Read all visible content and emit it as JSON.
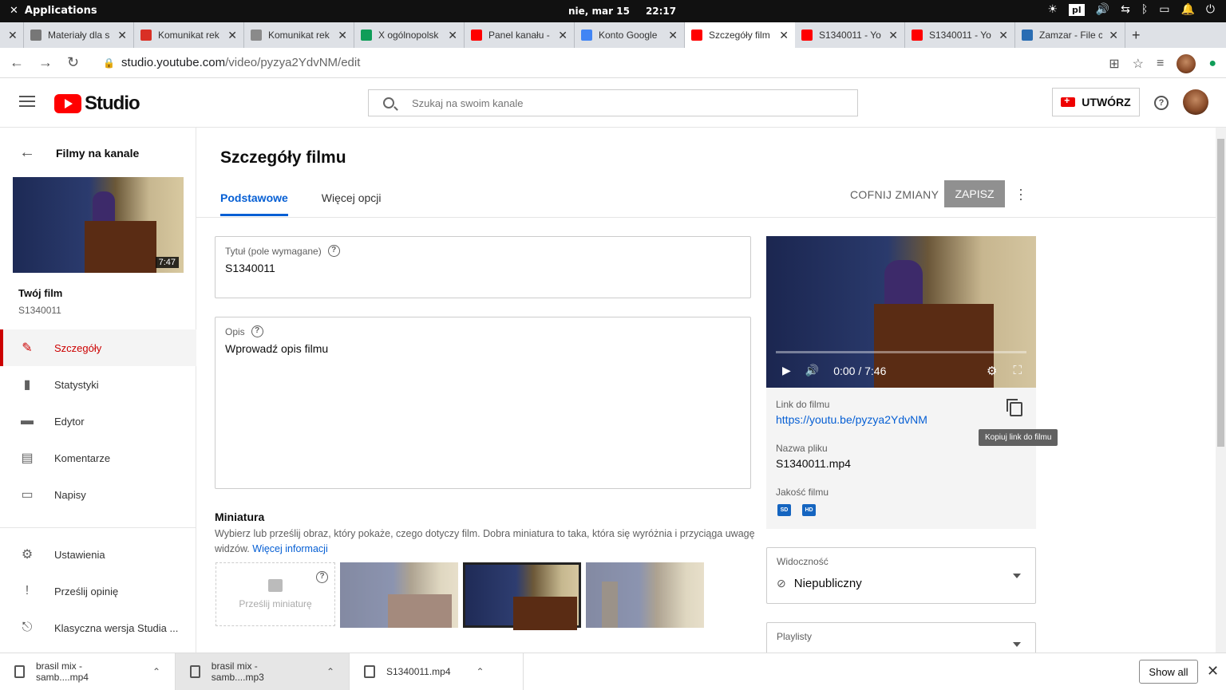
{
  "system_bar": {
    "apps_label": "Applications",
    "date": "nie, mar 15",
    "time": "22:17",
    "lang": "pl"
  },
  "browser_tabs": [
    {
      "title": "Materiały dla s",
      "color": "#777777"
    },
    {
      "title": "Komunikat rek",
      "color": "#d93025"
    },
    {
      "title": "Komunikat rek",
      "color": "#8a8a8a"
    },
    {
      "title": "X ogólnopolsk",
      "color": "#0f9d58"
    },
    {
      "title": "Panel kanału -",
      "color": "#ff0000"
    },
    {
      "title": "Konto Google",
      "color": "#4285f4"
    },
    {
      "title": "Szczegóły film",
      "color": "#ff0000",
      "active": true
    },
    {
      "title": "S1340011 - Yo",
      "color": "#ff0000"
    },
    {
      "title": "S1340011 - Yo",
      "color": "#ff0000"
    },
    {
      "title": "Zamzar - File c",
      "color": "#2a6db3"
    }
  ],
  "address_bar": {
    "domain": "studio.youtube.com",
    "path": "/video/pyzya2YdvNM/edit"
  },
  "studio_header": {
    "logo_text": "Studio",
    "search_placeholder": "Szukaj na swoim kanale",
    "create_label": "UTWÓRZ",
    "help_label": "?"
  },
  "sidebar": {
    "back_label": "Filmy na kanale",
    "thumb_duration": "7:47",
    "your_film_label": "Twój film",
    "your_film_id": "S1340011",
    "items": [
      {
        "label": "Szczegóły",
        "icon": "pencil-icon",
        "glyph": "✎",
        "active": true
      },
      {
        "label": "Statystyki",
        "icon": "analytics-icon",
        "glyph": "▮"
      },
      {
        "label": "Edytor",
        "icon": "editor-icon",
        "glyph": "▬"
      },
      {
        "label": "Komentarze",
        "icon": "comments-icon",
        "glyph": "▤"
      },
      {
        "label": "Napisy",
        "icon": "subtitles-icon",
        "glyph": "▭"
      }
    ],
    "bottom_items": [
      {
        "label": "Ustawienia",
        "icon": "gear-icon",
        "glyph": "⚙"
      },
      {
        "label": "Prześlij opinię",
        "icon": "feedback-icon",
        "glyph": "!"
      },
      {
        "label": "Klasyczna wersja Studia ...",
        "icon": "classic-icon",
        "glyph": "⎋"
      }
    ]
  },
  "main": {
    "page_title": "Szczegóły filmu",
    "tabs": [
      {
        "label": "Podstawowe",
        "active": true
      },
      {
        "label": "Więcej opcji"
      }
    ],
    "undo_label": "COFNIJ ZMIANY",
    "save_label": "ZAPISZ",
    "title_field": {
      "label": "Tytuł (pole wymagane)",
      "value": "S1340011"
    },
    "description_field": {
      "label": "Opis",
      "value": "Wprowadź opis filmu"
    },
    "thumbnail": {
      "heading": "Miniatura",
      "description": "Wybierz lub prześlij obraz, który pokaże, czego dotyczy film. Dobra miniatura to taka, która się wyróżnia i przyciąga uwagę widzów.",
      "more_link": "Więcej informacji",
      "upload_label": "Prześlij miniaturę"
    }
  },
  "video_panel": {
    "time_display": "0:00 / 7:46",
    "link_label": "Link do filmu",
    "link_value": "https://youtu.be/pyzya2YdvNM",
    "copy_tooltip": "Kopiuj link do filmu",
    "filename_label": "Nazwa pliku",
    "filename_value": "S1340011.mp4",
    "quality_label": "Jakość filmu",
    "quality_badges": [
      "SD",
      "HD"
    ],
    "visibility_label": "Widoczność",
    "visibility_value": "Niepubliczny",
    "playlists_label": "Playlisty"
  },
  "downloads": {
    "items": [
      {
        "name": "brasil mix - samb....mp4"
      },
      {
        "name": "brasil mix - samb....mp3",
        "highlight": true
      },
      {
        "name": "S1340011.mp4"
      }
    ],
    "show_all": "Show all"
  }
}
